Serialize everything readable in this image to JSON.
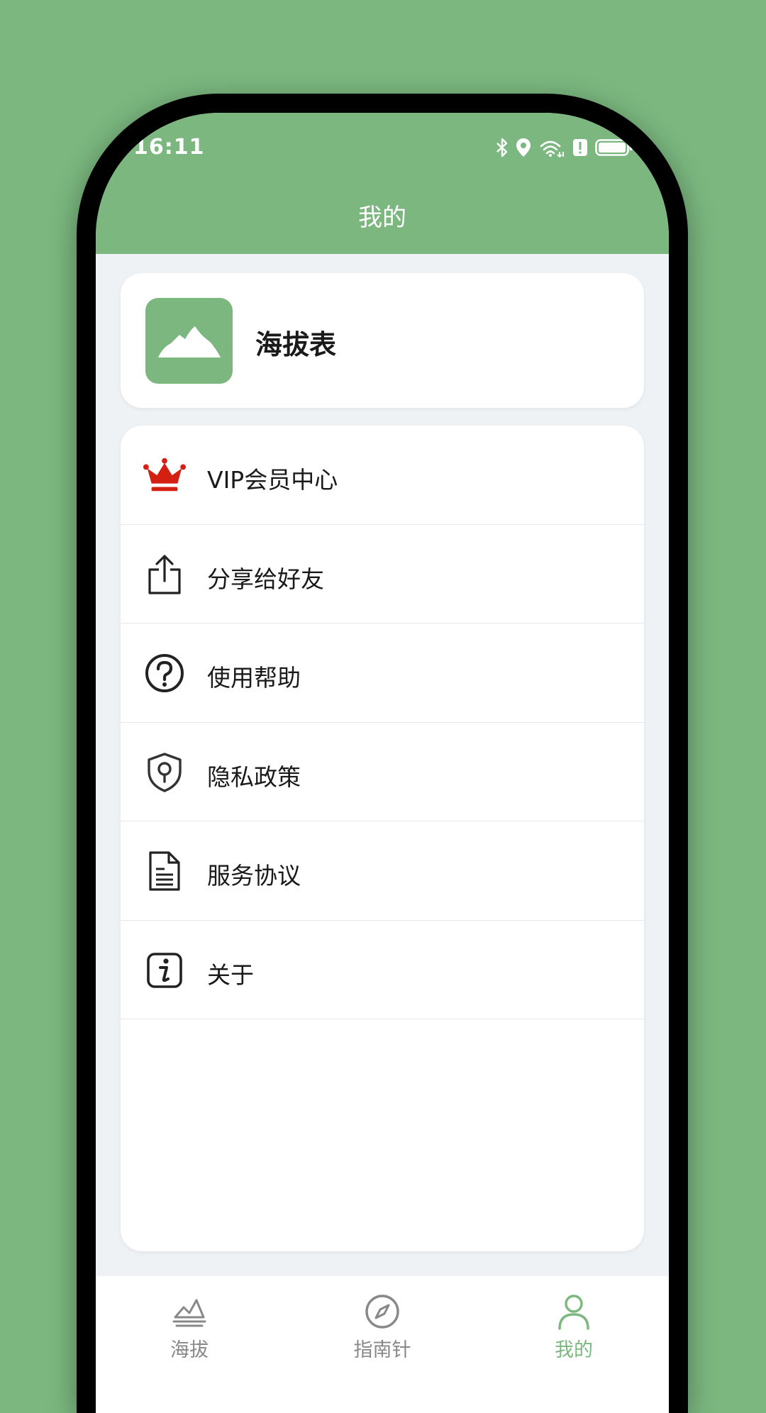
{
  "status_bar": {
    "time": "16:11"
  },
  "header": {
    "title": "我的"
  },
  "app_card": {
    "name": "海拔表"
  },
  "menu": {
    "items": [
      {
        "label": "VIP会员中心",
        "icon": "crown-icon"
      },
      {
        "label": "分享给好友",
        "icon": "share-icon"
      },
      {
        "label": "使用帮助",
        "icon": "help-icon"
      },
      {
        "label": "隐私政策",
        "icon": "shield-lock-icon"
      },
      {
        "label": "服务协议",
        "icon": "document-icon"
      },
      {
        "label": "关于",
        "icon": "info-icon"
      }
    ]
  },
  "tabbar": {
    "tabs": [
      {
        "label": "海拔",
        "icon": "mountain-icon",
        "active": false
      },
      {
        "label": "指南针",
        "icon": "compass-icon",
        "active": false
      },
      {
        "label": "我的",
        "icon": "person-icon",
        "active": true
      }
    ]
  },
  "colors": {
    "brand": "#7bb77f",
    "crown": "#d42012",
    "background": "#eef2f4"
  }
}
